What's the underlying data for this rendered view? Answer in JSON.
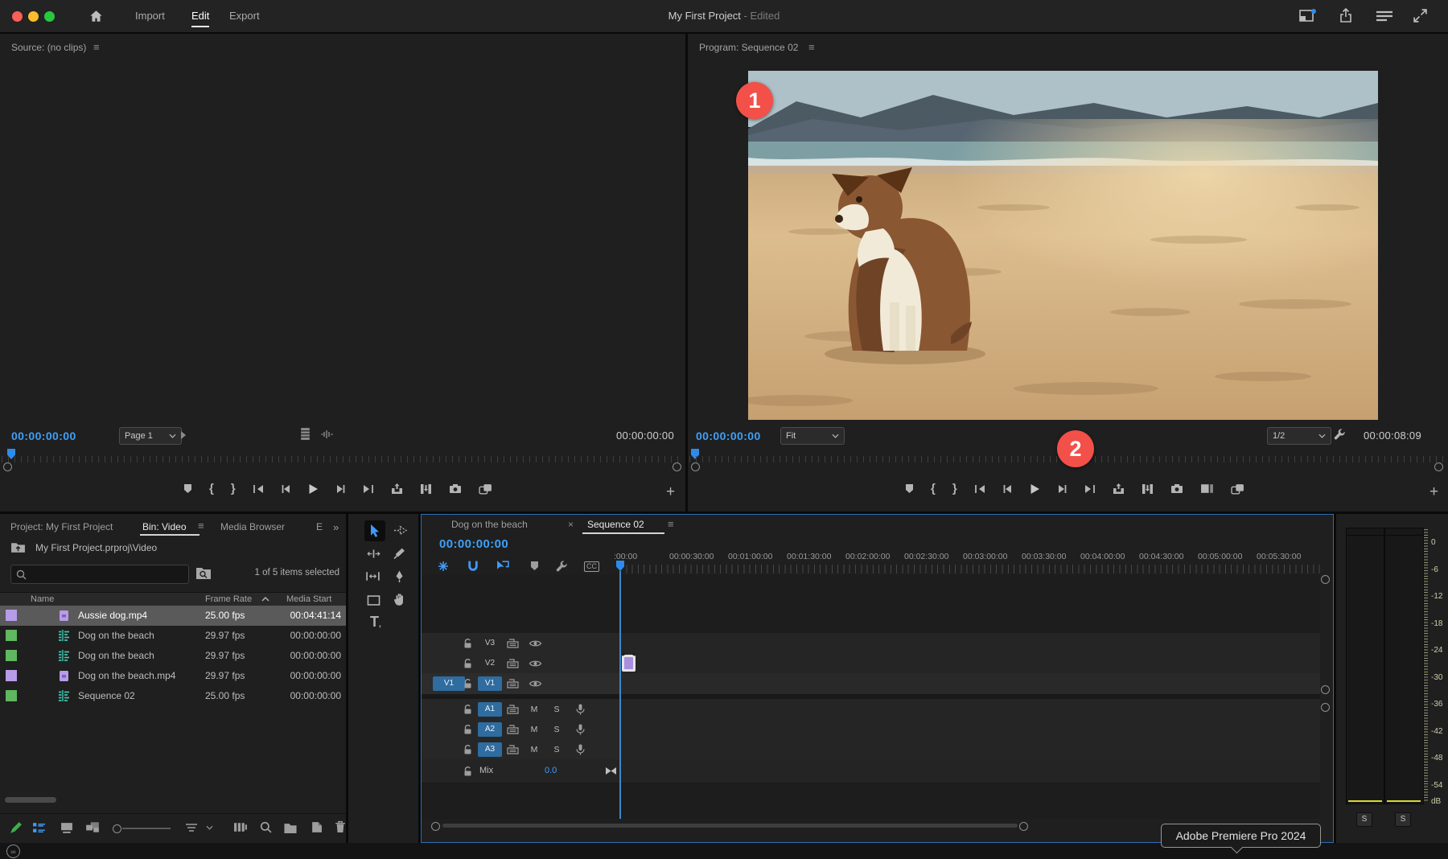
{
  "titlebar": {
    "tabs": [
      {
        "label": "Import"
      },
      {
        "label": "Edit"
      },
      {
        "label": "Export"
      }
    ],
    "title": "My First Project",
    "edited": "- Edited"
  },
  "source": {
    "header": "Source: (no clips)",
    "timecode": "00:00:00:00",
    "page": "Page 1",
    "duration": "00:00:00:00"
  },
  "program": {
    "header": "Program: Sequence 02",
    "timecode": "00:00:00:00",
    "fit": "Fit",
    "quality": "1/2",
    "duration": "00:00:08:09",
    "badge_1": "1",
    "badge_2": "2"
  },
  "project": {
    "tab_project": "Project: My First Project",
    "tab_bin": "Bin: Video",
    "tab_media": "Media Browser",
    "tab_truncated": "E",
    "path": "My First Project.prproj\\Video",
    "status": "1 of 5 items selected",
    "columns": {
      "name": "Name",
      "rate": "Frame Rate",
      "start": "Media Start"
    },
    "items": [
      {
        "name": "Aussie dog.mp4",
        "rate": "25.00 fps",
        "start": "00:04:41:14"
      },
      {
        "name": "Dog on the beach",
        "rate": "29.97 fps",
        "start": "00:00:00:00"
      },
      {
        "name": "Dog on the beach",
        "rate": "29.97 fps",
        "start": "00:00:00:00"
      },
      {
        "name": "Dog on the beach.mp4",
        "rate": "29.97 fps",
        "start": "00:00:00:00"
      },
      {
        "name": "Sequence 02",
        "rate": "25.00 fps",
        "start": "00:00:00:00"
      }
    ]
  },
  "timeline": {
    "tab_inactive": "Dog on the beach",
    "tab_active": "Sequence 02",
    "timecode": "00:00:00:00",
    "ruler": [
      ":00:00",
      "00:00:30:00",
      "00:01:00:00",
      "00:01:30:00",
      "00:02:00:00",
      "00:02:30:00",
      "00:03:00:00",
      "00:03:30:00",
      "00:04:00:00",
      "00:04:30:00",
      "00:05:00:00",
      "00:05:30:00"
    ],
    "tracks": {
      "v": [
        "V3",
        "V2",
        "V1"
      ],
      "a": [
        "A1",
        "A2",
        "A3"
      ]
    },
    "patch_v1": "V1",
    "mix_label": "Mix",
    "mix_value": "0.0",
    "mute": "M",
    "solo": "S",
    "captions": "CC"
  },
  "meters": {
    "scale": [
      "0",
      "-6",
      "-12",
      "-18",
      "-24",
      "-30",
      "-36",
      "-42",
      "-48",
      "-54",
      "dB"
    ],
    "solo": "S"
  },
  "tooltip": "Adobe Premiere Pro 2024",
  "colors": {
    "accent_blue": "#2d8ceb",
    "timecode_blue": "#3ea0f8",
    "badge_red": "#f25048",
    "clip_purple": "#b79ce8",
    "sequence_green": "#5fb75f",
    "meter_yellow": "#d8d832",
    "traffic_red": "#f85f57",
    "traffic_yellow": "#fbbc2e",
    "traffic_green": "#29c73f"
  }
}
